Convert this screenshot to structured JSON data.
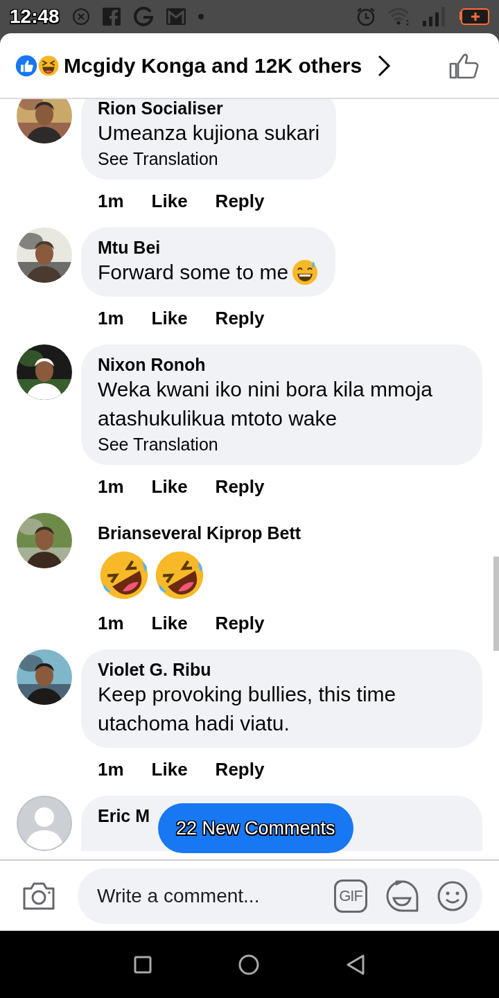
{
  "status_bar": {
    "time": "12:48"
  },
  "header": {
    "title": "Mcgidy Konga and 12K others"
  },
  "comments": [
    {
      "name": "Rion Socialiser",
      "avatar": {
        "kind": "picture"
      },
      "parts": [
        {
          "kind": "text",
          "text": "Umeanza kujiona sukari"
        }
      ],
      "see_translation": "See Translation",
      "time": "1m",
      "like": "Like",
      "reply": "Reply"
    },
    {
      "name": "Mtu Bei",
      "avatar": {
        "kind": "picture"
      },
      "parts": [
        {
          "kind": "text",
          "text": "Forward some to me"
        },
        {
          "kind": "sweat_smile"
        }
      ],
      "time": "1m",
      "like": "Like",
      "reply": "Reply"
    },
    {
      "name": "Nixon Ronoh",
      "avatar": {
        "kind": "picture"
      },
      "parts": [
        {
          "kind": "text",
          "text": "Weka kwani iko nini bora kila mmoja atashukulikua mtoto wake"
        }
      ],
      "see_translation": "See Translation",
      "time": "1m",
      "like": "Like",
      "reply": "Reply"
    },
    {
      "name": "Brianseveral Kiprop Bett",
      "avatar": {
        "kind": "picture"
      },
      "parts": [
        {
          "kind": "rofl"
        },
        {
          "kind": "rofl"
        }
      ],
      "time": "1m",
      "like": "Like",
      "reply": "Reply"
    },
    {
      "name": "Violet G. Ribu",
      "avatar": {
        "kind": "picture"
      },
      "parts": [
        {
          "kind": "text",
          "text": "Keep provoking bullies, this time utachoma hadi viatu."
        }
      ],
      "time": "1m",
      "like": "Like",
      "reply": "Reply"
    },
    {
      "name": "Eric M",
      "avatar": {
        "kind": "default"
      },
      "cut": true
    }
  ],
  "new_comments_pill": "22 New Comments",
  "composer": {
    "placeholder": "Write a comment...",
    "gif_label": "GIF"
  }
}
